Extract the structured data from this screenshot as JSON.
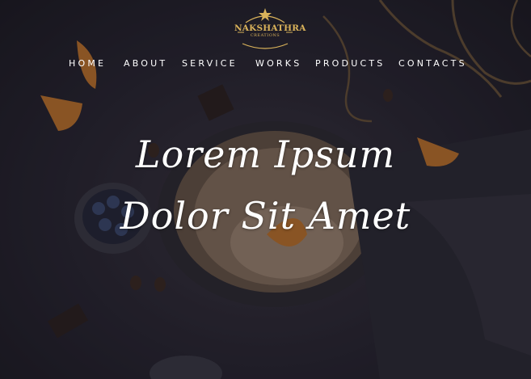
{
  "logo": {
    "name": "NAKSHATHRA",
    "sub": "CREATIONS"
  },
  "nav": {
    "items": [
      "HOME",
      "ABOUT",
      "SERVICE",
      "WORKS",
      "PRODUCTS",
      "CONTACTS"
    ]
  },
  "hero": {
    "line1": "Lorem Ipsum",
    "line2": "Dolor Sit Amet"
  },
  "colors": {
    "accent": "#d9b25a",
    "text": "#ffffff",
    "background": "#26242f"
  }
}
